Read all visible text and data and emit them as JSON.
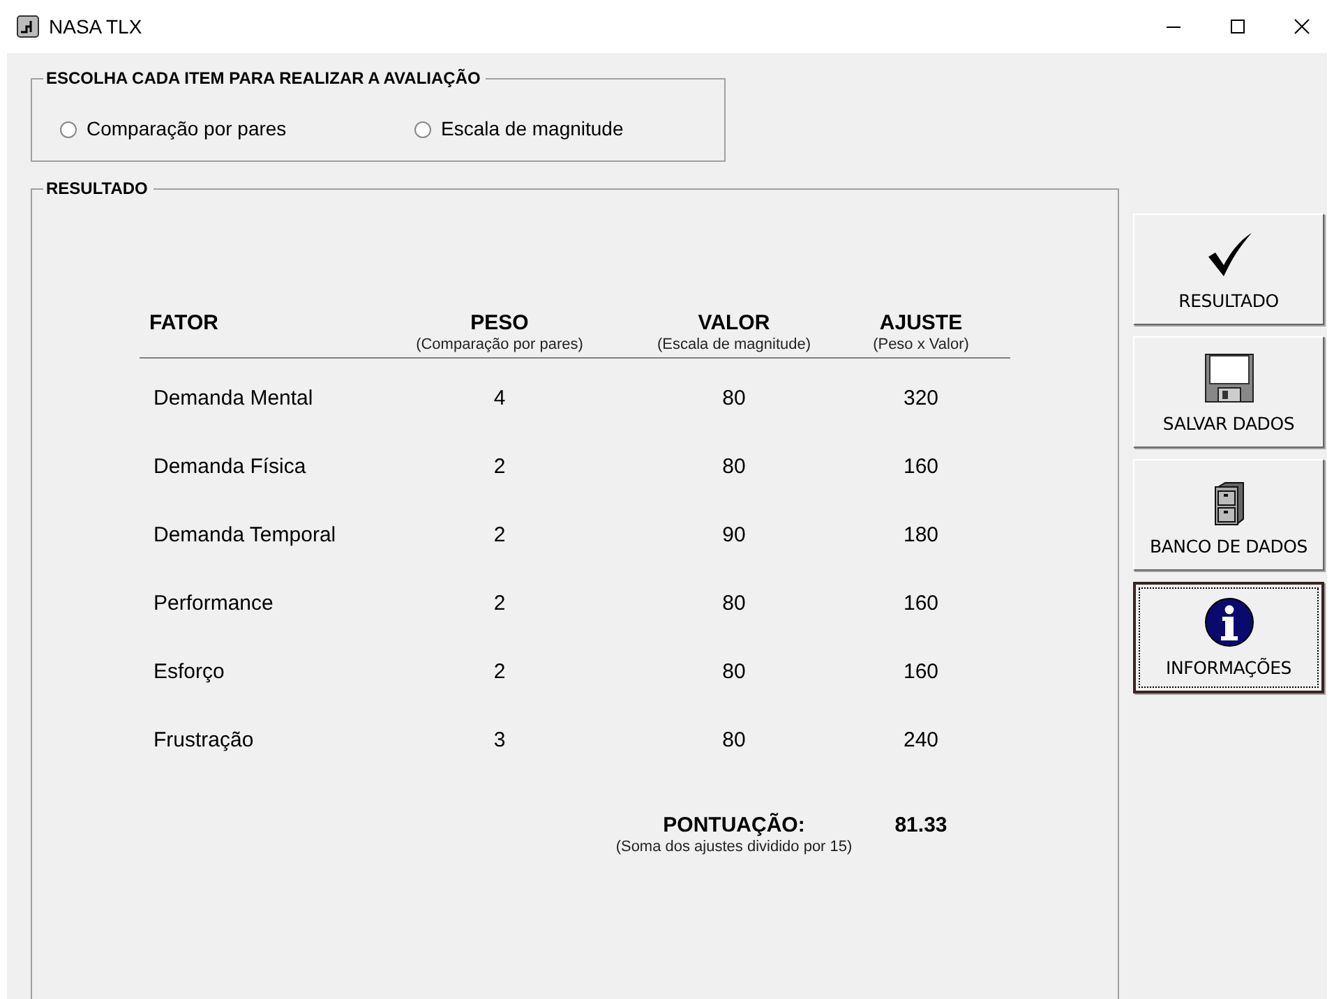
{
  "window": {
    "title": "NASA TLX"
  },
  "choice_group": {
    "title": "ESCOLHA CADA ITEM PARA REALIZAR A AVALIAÇÃO",
    "options": [
      {
        "label": "Comparação por pares",
        "selected": false
      },
      {
        "label": "Escala de magnitude",
        "selected": false
      }
    ]
  },
  "result_group": {
    "title": "RESULTADO",
    "columns": [
      {
        "title": "FATOR"
      },
      {
        "title": "PESO",
        "subtitle": "(Comparação por pares)"
      },
      {
        "title": "VALOR",
        "subtitle": "(Escala de magnitude)"
      },
      {
        "title": "AJUSTE",
        "subtitle": "(Peso x Valor)"
      }
    ],
    "rows": [
      [
        "Demanda Mental",
        "4",
        "80",
        "320"
      ],
      [
        "Demanda Física",
        "2",
        "80",
        "160"
      ],
      [
        "Demanda Temporal",
        "2",
        "90",
        "180"
      ],
      [
        "Performance",
        "2",
        "80",
        "160"
      ],
      [
        "Esforço",
        "2",
        "80",
        "160"
      ],
      [
        "Frustração",
        "3",
        "80",
        "240"
      ]
    ],
    "score": {
      "label": "PONTUAÇÃO:",
      "value": "81.33",
      "note": "(Soma dos ajustes dividido por 15)"
    }
  },
  "buttons": [
    {
      "label": "RESULTADO",
      "focused": false
    },
    {
      "label": "SALVAR DADOS",
      "focused": false
    },
    {
      "label": "BANCO DE DADOS",
      "focused": false
    },
    {
      "label": "INFORMAÇÕES",
      "focused": true
    }
  ]
}
